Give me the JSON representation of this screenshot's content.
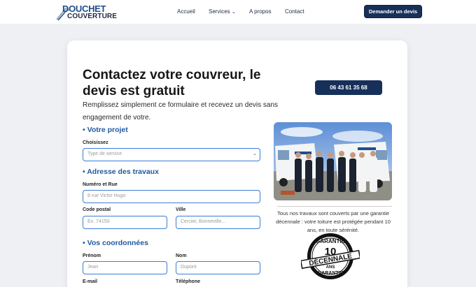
{
  "header": {
    "logo_line1": "DOUCHET",
    "logo_line2": "COUVERTURE",
    "nav": [
      "Accueil",
      "Services",
      "A propos",
      "Contact"
    ],
    "cta": "Demander un devis"
  },
  "hero": {
    "title": "Contactez votre couvreur, le devis est gratuit",
    "subtitle": "Remplissez simplement ce formulaire et recevez un devis sans engagement de votre.",
    "phone": "06 43 61 35 68"
  },
  "form": {
    "project": {
      "heading": "• Votre projet",
      "choose_label": "Choisissez",
      "choose_value": "Type de service"
    },
    "address": {
      "heading": "• Adresse des travaux",
      "street_label": "Numéro et Rue",
      "street_placeholder": "8 rue Victor Hugo",
      "postal_label": "Code postal",
      "postal_placeholder": "Ex. 74150",
      "city_label": "Ville",
      "city_placeholder": "Cercier, Bonneville..."
    },
    "contact": {
      "heading": "• Vos coordonnées",
      "first_label": "Prénom",
      "first_placeholder": "Jean",
      "last_label": "Nom",
      "last_placeholder": "Dupont",
      "email_label": "E-mail",
      "phone_label": "Téléphone"
    }
  },
  "aside": {
    "guarantee_text": "Tous nos travaux sont couverts par une garantie décennale : votre toiture est protégée pendant 10 ans, en toute sérénité.",
    "badge_top": "GARANTIE",
    "badge_number": "10",
    "badge_main": "DÉCENNALE",
    "badge_sub": "ANS",
    "badge_bottom": "GARANTIE"
  },
  "colors": {
    "brand_navy": "#17305a",
    "accent_blue": "#1f5aa0",
    "field_border": "#3b7dd8"
  }
}
